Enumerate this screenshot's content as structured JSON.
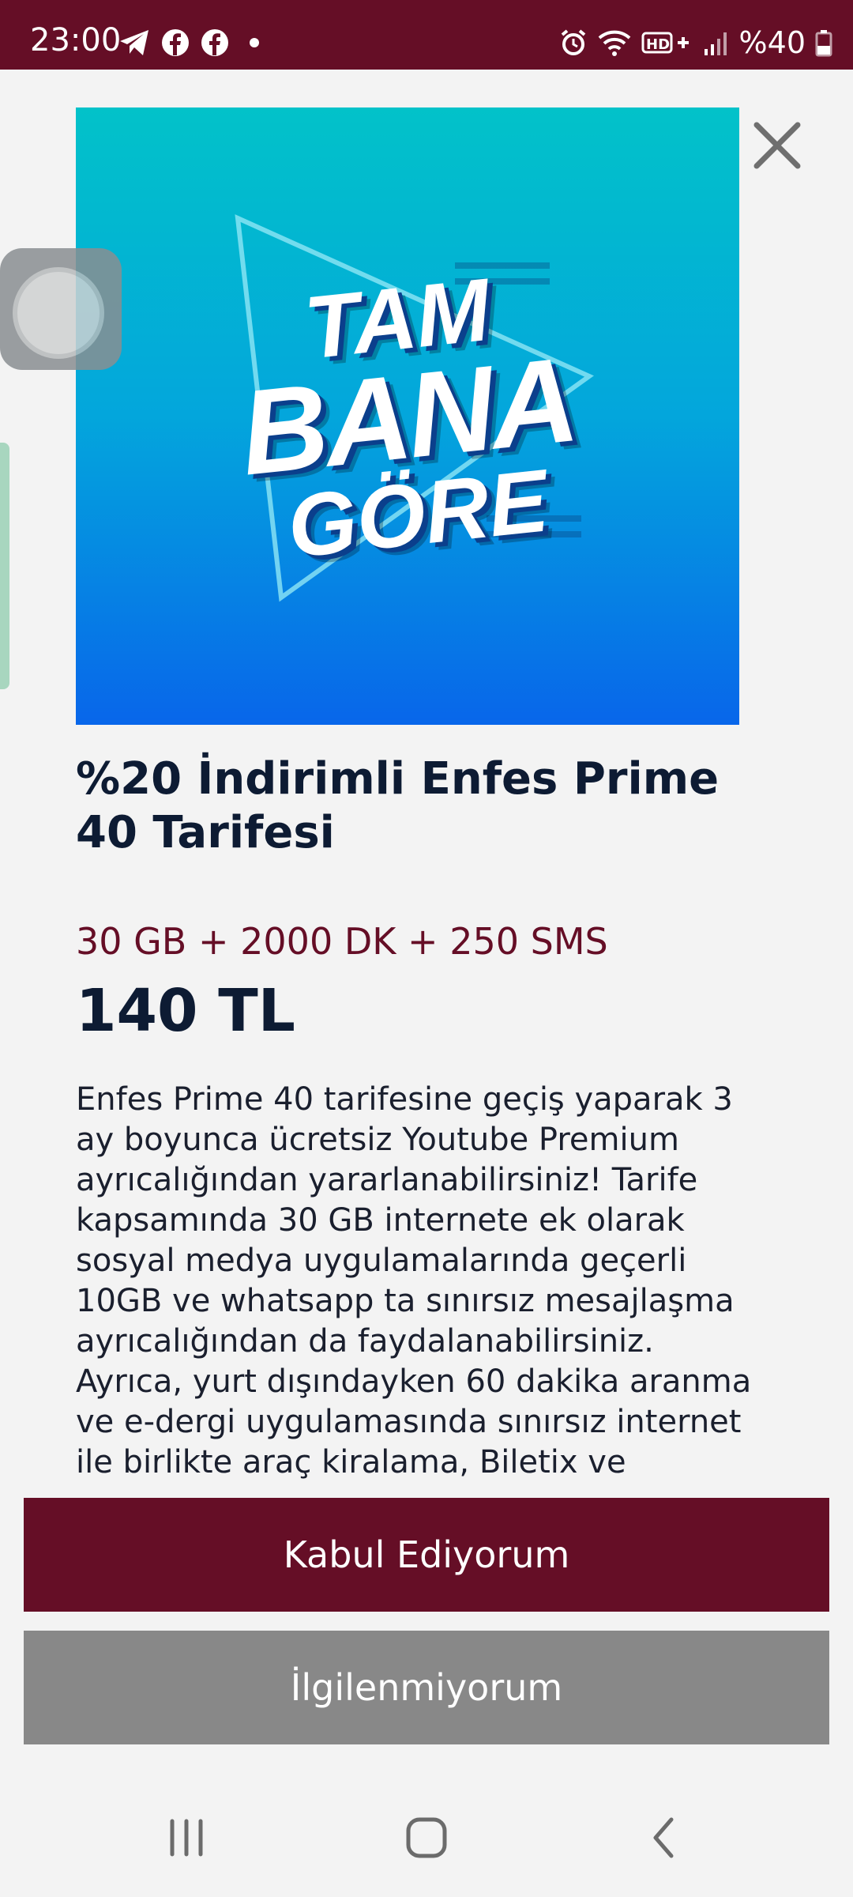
{
  "status_bar": {
    "time": "23:00",
    "battery": "%40",
    "left_icons": [
      "telegram-icon",
      "facebook-icon",
      "facebook-icon",
      "dot-icon"
    ],
    "right_icons": [
      "alarm-icon",
      "wifi-icon",
      "hd-plus-icon",
      "signal-icon",
      "battery-icon"
    ]
  },
  "promo": {
    "line1": "TAM",
    "line2": "BANA",
    "line3": "GÖRE"
  },
  "offer": {
    "title": "%20 İndirimli Enfes Prime 40 Tarifesi",
    "package": "30 GB + 2000 DK + 250 SMS",
    "price": "140 TL",
    "description": "Enfes Prime 40 tarifesine geçiş yaparak 3 ay boyunca ücretsiz Youtube Premium ayrıcalığından yararlanabilirsiniz! Tarife kapsamında 30 GB internete ek olarak sosyal medya uygulamalarında geçerli 10GB ve whatsapp ta sınırsız mesajlaşma ayrıcalığından da faydalanabilirsiniz. Ayrıca, yurt dışındayken 60 dakika aranma ve e-dergi uygulamasında sınırsız internet ile birlikte araç kiralama, Biletix ve"
  },
  "buttons": {
    "accept": "Kabul Ediyorum",
    "decline": "İlgilenmiyorum"
  },
  "colors": {
    "brand": "#650e26",
    "decline": "#888888",
    "promo_top": "#02c2c9",
    "promo_bottom": "#0866ea"
  }
}
